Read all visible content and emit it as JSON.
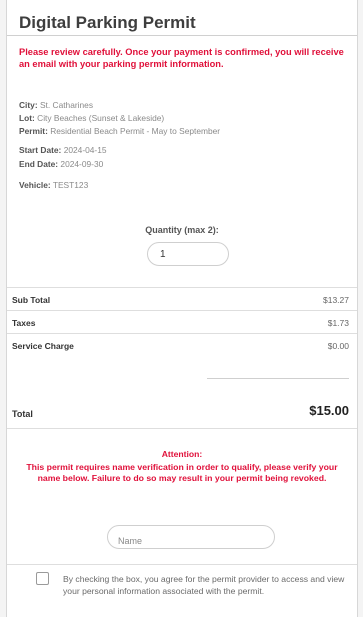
{
  "header": {
    "title": "Digital Parking Permit"
  },
  "warning": "Please review carefully. Once your payment is confirmed, you will receive an email with your parking permit information.",
  "details": {
    "city_label": "City:",
    "city": "St. Catharines",
    "lot_label": "Lot:",
    "lot": "City Beaches (Sunset & Lakeside)",
    "permit_label": "Permit:",
    "permit": "Residential Beach Permit - May to September",
    "start_label": "Start Date:",
    "start": "2024-04-15",
    "end_label": "End Date:",
    "end": "2024-09-30",
    "vehicle_label": "Vehicle:",
    "vehicle": "TEST123"
  },
  "quantity": {
    "label": "Quantity (max 2):",
    "value": "1"
  },
  "summary": {
    "subtotal_label": "Sub Total",
    "subtotal": "$13.27",
    "taxes_label": "Taxes",
    "taxes": "$1.73",
    "service_label": "Service Charge",
    "service": "$0.00",
    "total_label": "Total",
    "total": "$15.00"
  },
  "attention": {
    "title": "Attention:",
    "body": "This permit requires name verification in order to qualify, please verify your name below. Failure to do so may result in your permit being revoked."
  },
  "name_field": {
    "placeholder": "Name"
  },
  "consent": {
    "text": "By checking the box, you agree for the permit provider to access and view your personal information associated with the permit."
  },
  "colors": {
    "alert": "#e0103a"
  }
}
